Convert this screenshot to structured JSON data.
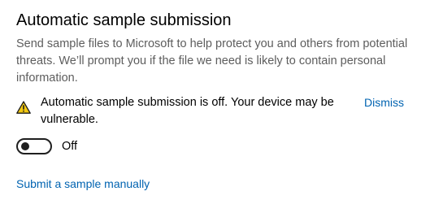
{
  "section": {
    "title": "Automatic sample submission",
    "description": "Send sample files to Microsoft to help protect you and others from potential threats. We’ll prompt you if the file we need is likely to contain personal information."
  },
  "warning": {
    "icon": "warning-icon",
    "icon_color": "#f2c811",
    "message": "Automatic sample submission is off. Your device may be vulnerable.",
    "dismiss_label": "Dismiss"
  },
  "toggle": {
    "state_label": "Off",
    "is_on": false
  },
  "links": {
    "submit_manually": "Submit a sample manually"
  },
  "colors": {
    "link": "#0063b1",
    "description_text": "#5d5d5d"
  }
}
